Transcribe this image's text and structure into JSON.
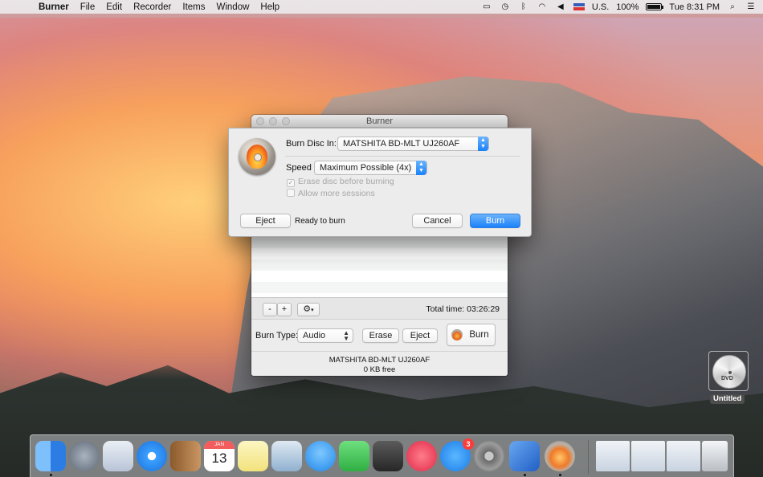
{
  "menubar": {
    "apple_glyph": "",
    "app_name": "Burner",
    "menus": [
      "File",
      "Edit",
      "Recorder",
      "Items",
      "Window",
      "Help"
    ],
    "input_source": "U.S.",
    "battery": "100%",
    "battery_level": 1.0,
    "clock": "Tue 8:31 PM",
    "status_icons": [
      "menu-extra-icon",
      "time-machine-icon",
      "bluetooth-icon",
      "wifi-icon",
      "volume-icon",
      "flag-icon",
      "spotlight-icon",
      "notification-center-icon"
    ]
  },
  "window": {
    "title": "Burner",
    "remove_button": "-",
    "add_button": "+",
    "gear_glyph": "⚙",
    "total_time_label": "Total time: 03:26:29",
    "burn_type_label": "Burn Type:",
    "burn_type_value": "Audio",
    "erase_button": "Erase",
    "eject_button": "Eject",
    "burn_button": "Burn",
    "drive_name": "MATSHITA BD-MLT UJ260AF",
    "free_space": "0 KB free"
  },
  "sheet": {
    "burn_in_label": "Burn Disc In:",
    "burn_in_value": "MATSHITA BD-MLT UJ260AF",
    "speed_label": "Speed",
    "speed_value": "Maximum Possible (4x)",
    "erase_checkbox": "Erase disc before burning",
    "sessions_checkbox": "Allow more sessions",
    "eject_button": "Eject",
    "status": "Ready to burn",
    "cancel_button": "Cancel",
    "burn_button": "Burn"
  },
  "desktop": {
    "dvd_label": "Untitled",
    "dvd_icon_text": "DVD"
  },
  "dock": {
    "calendar_month": "JAN",
    "calendar_day": "13",
    "appstore_badge": "3",
    "colors": {
      "finder": "#3d8ef0",
      "launchpad": "#7a8796",
      "mail": "#cfd8e6",
      "safari": "#2f8ff0",
      "contacts": "#b88652",
      "notes": "#fbf0a8",
      "preview": "#8fb8d8",
      "messages": "#3ea2f5",
      "facetime": "#3ec756",
      "photobooth": "#3a3a3a",
      "itunes": "#f14a5e",
      "appstore": "#2f97f5",
      "sysprefs": "#8c8c8c",
      "xcode": "#2a6fd6",
      "burner": "#d28b52",
      "trash": "#e6e8ea"
    }
  }
}
